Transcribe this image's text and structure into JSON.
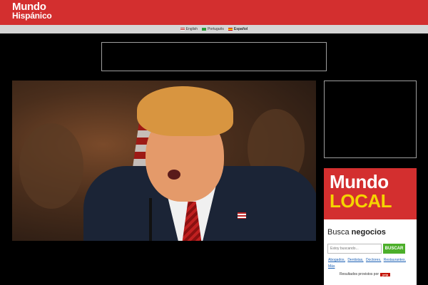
{
  "header": {
    "logo_line1": "Mundo",
    "logo_line2": "Hispánico"
  },
  "languages": [
    {
      "label": "English",
      "active": false
    },
    {
      "label": "Português",
      "active": false
    },
    {
      "label": "Español",
      "active": true
    }
  ],
  "article": {
    "caption_tag": "",
    "headline": "",
    "photo_alt": ""
  },
  "mundo_local": {
    "logo_line1": "Mundo",
    "logo_line2": "LOCAL",
    "busca_prefix": "Busca",
    "busca_bold": "negocios",
    "search_placeholder": "Estoy buscando...",
    "search_button": "BUSCAR",
    "categories": [
      "Abogados,",
      "Dentistas,",
      "Doctores,",
      "Restaurantes,",
      "Más"
    ],
    "powered_text": "Resultados provistos por",
    "powered_brand": "yelp"
  }
}
